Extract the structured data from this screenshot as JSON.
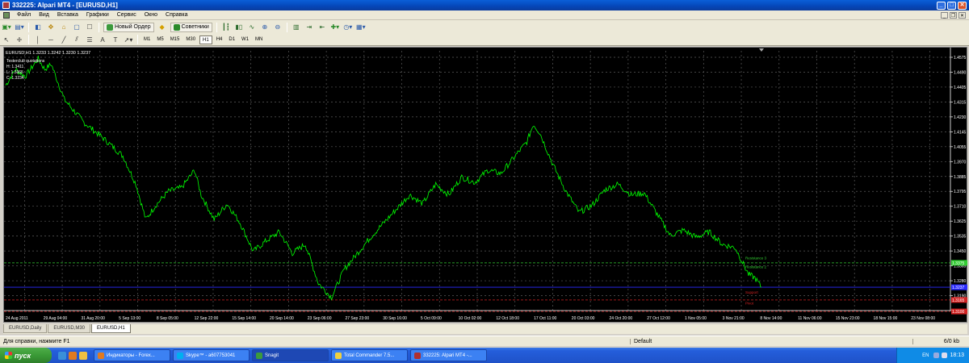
{
  "window": {
    "title": "332225: Alpari MT4 - [EURUSD,H1]"
  },
  "menu": {
    "items": [
      "Файл",
      "Вид",
      "Вставка",
      "Графики",
      "Сервис",
      "Окно",
      "Справка"
    ]
  },
  "toolbar": {
    "new_order_label": "Новый Ордер",
    "experts_label": "Советники",
    "timeframes": [
      "M1",
      "M5",
      "M15",
      "M30",
      "H1",
      "H4",
      "D1",
      "W1",
      "MN"
    ],
    "active_timeframe": "H1"
  },
  "chart": {
    "header": "EURUSD,H1  1.3233 1.3242 1.3230 1.3237",
    "quotes_lines": [
      "Testerclub quotations",
      "H: 1.3411",
      "L: 1.3365",
      "C: 1.3234"
    ],
    "colors": {
      "background": "#000000",
      "grid": "#5a5a5a",
      "price": "#00ff00",
      "resistance": "#32cd32",
      "current": "#2a2aff",
      "support": "#d22222",
      "axis_text": "#ffffff"
    },
    "y_ticks": [
      "1.4575",
      "1.4490",
      "1.4405",
      "1.4315",
      "1.4230",
      "1.4145",
      "1.4055",
      "1.3970",
      "1.3885",
      "1.3795",
      "1.3710",
      "1.3625",
      "1.3535",
      "1.3450",
      "1.3365",
      "1.3280",
      "1.3190",
      "1.3105"
    ],
    "x_ticks": [
      "24 Aug 2011",
      "29 Aug 04:00",
      "31 Aug 20:00",
      "5 Sep 13:00",
      "8 Sep 05:00",
      "12 Sep 22:00",
      "15 Sep 14:00",
      "20 Sep 14:00",
      "23 Sep 06:00",
      "27 Sep 23:00",
      "30 Sep 16:00",
      "5 Oct 09:00",
      "10 Oct 02:00",
      "12 Oct 18:00",
      "17 Oct 11:00",
      "20 Oct 03:00",
      "24 Oct 20:00",
      "27 Oct 12:00",
      "1 Nov 05:00",
      "3 Nov 21:00",
      "8 Nov 14:00",
      "11 Nov 06:00",
      "15 Nov 23:00",
      "18 Nov 15:00",
      "23 Nov 08:00"
    ],
    "ylim": [
      1.3105,
      1.4575
    ],
    "levels": [
      {
        "name": "resistance",
        "value": 1.3375,
        "label": "1.3375"
      },
      {
        "name": "current",
        "value": 1.3237,
        "label": "1.3237"
      },
      {
        "name": "support-1",
        "value": 1.3165,
        "label": "1.3165"
      },
      {
        "name": "support-2",
        "value": 1.31,
        "label": "1.3100"
      }
    ],
    "level_texts": [
      "Resistance 3",
      "Resistance 2",
      "Support",
      "Pivot"
    ],
    "price_anchors": [
      [
        0,
        1.438
      ],
      [
        3,
        1.447
      ],
      [
        6,
        1.443
      ],
      [
        10,
        1.453
      ],
      [
        12,
        1.447
      ],
      [
        14,
        1.45
      ],
      [
        18,
        1.43
      ],
      [
        24,
        1.417
      ],
      [
        30,
        1.408
      ],
      [
        36,
        1.398
      ],
      [
        40,
        1.382
      ],
      [
        43,
        1.362
      ],
      [
        46,
        1.37
      ],
      [
        50,
        1.378
      ],
      [
        54,
        1.38
      ],
      [
        58,
        1.39
      ],
      [
        60,
        1.376
      ],
      [
        64,
        1.362
      ],
      [
        68,
        1.371
      ],
      [
        72,
        1.36
      ],
      [
        76,
        1.344
      ],
      [
        80,
        1.35
      ],
      [
        84,
        1.355
      ],
      [
        88,
        1.343
      ],
      [
        92,
        1.348
      ],
      [
        96,
        1.326
      ],
      [
        100,
        1.318
      ],
      [
        104,
        1.334
      ],
      [
        108,
        1.343
      ],
      [
        112,
        1.352
      ],
      [
        116,
        1.36
      ],
      [
        120,
        1.368
      ],
      [
        124,
        1.376
      ],
      [
        128,
        1.371
      ],
      [
        132,
        1.382
      ],
      [
        136,
        1.376
      ],
      [
        140,
        1.386
      ],
      [
        144,
        1.383
      ],
      [
        148,
        1.39
      ],
      [
        152,
        1.388
      ],
      [
        156,
        1.397
      ],
      [
        160,
        1.406
      ],
      [
        162,
        1.416
      ],
      [
        164,
        1.411
      ],
      [
        168,
        1.393
      ],
      [
        172,
        1.378
      ],
      [
        176,
        1.366
      ],
      [
        180,
        1.37
      ],
      [
        184,
        1.379
      ],
      [
        188,
        1.382
      ],
      [
        192,
        1.376
      ],
      [
        196,
        1.377
      ],
      [
        200,
        1.365
      ],
      [
        204,
        1.353
      ],
      [
        208,
        1.356
      ],
      [
        212,
        1.352
      ],
      [
        216,
        1.355
      ],
      [
        220,
        1.348
      ],
      [
        224,
        1.346
      ],
      [
        228,
        1.331
      ],
      [
        230,
        1.329
      ],
      [
        232,
        1.3237
      ]
    ]
  },
  "tabs": [
    "EURUSD,Daily",
    "EURUSD,M30",
    "EURUSD,H1"
  ],
  "active_tab": "EURUSD,H1",
  "status": {
    "help": "Для справки, нажмите F1",
    "profile": "Default",
    "traffic": "6/0 kb"
  },
  "taskbar": {
    "start_label": "пуск",
    "tasks": [
      "Индикаторы - Forex...",
      "Skype™ - a607753041",
      "Snagit",
      "Total Commander 7.5...",
      "332225: Alpari MT4 -..."
    ],
    "lang": "EN",
    "clock": "18:13"
  }
}
